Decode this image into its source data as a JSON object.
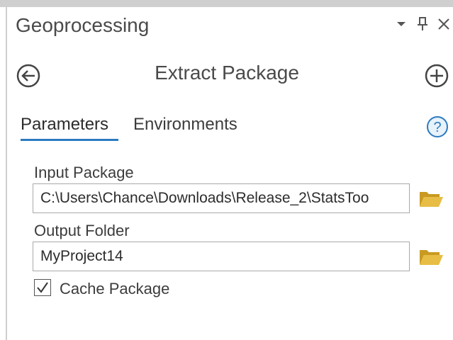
{
  "pane": {
    "title": "Geoprocessing",
    "controls": {
      "dropdown_icon": "dropdown-triangle-icon",
      "pin_icon": "pin-icon",
      "close_icon": "close-icon"
    }
  },
  "tool": {
    "title": "Extract Package",
    "back_icon": "back-arrow-icon",
    "add_icon": "add-icon"
  },
  "tabs": [
    {
      "label": "Parameters",
      "active": true
    },
    {
      "label": "Environments",
      "active": false
    }
  ],
  "help_icon": "help-icon",
  "params": {
    "input_package": {
      "label": "Input Package",
      "value": "C:\\Users\\Chance\\Downloads\\Release_2\\StatsToo"
    },
    "output_folder": {
      "label": "Output Folder",
      "value": "MyProject14"
    },
    "cache_package": {
      "label": "Cache Package",
      "checked": true
    }
  },
  "colors": {
    "accent": "#2b7bc0",
    "folder": "#e2b437",
    "border": "#cfcfcf"
  }
}
